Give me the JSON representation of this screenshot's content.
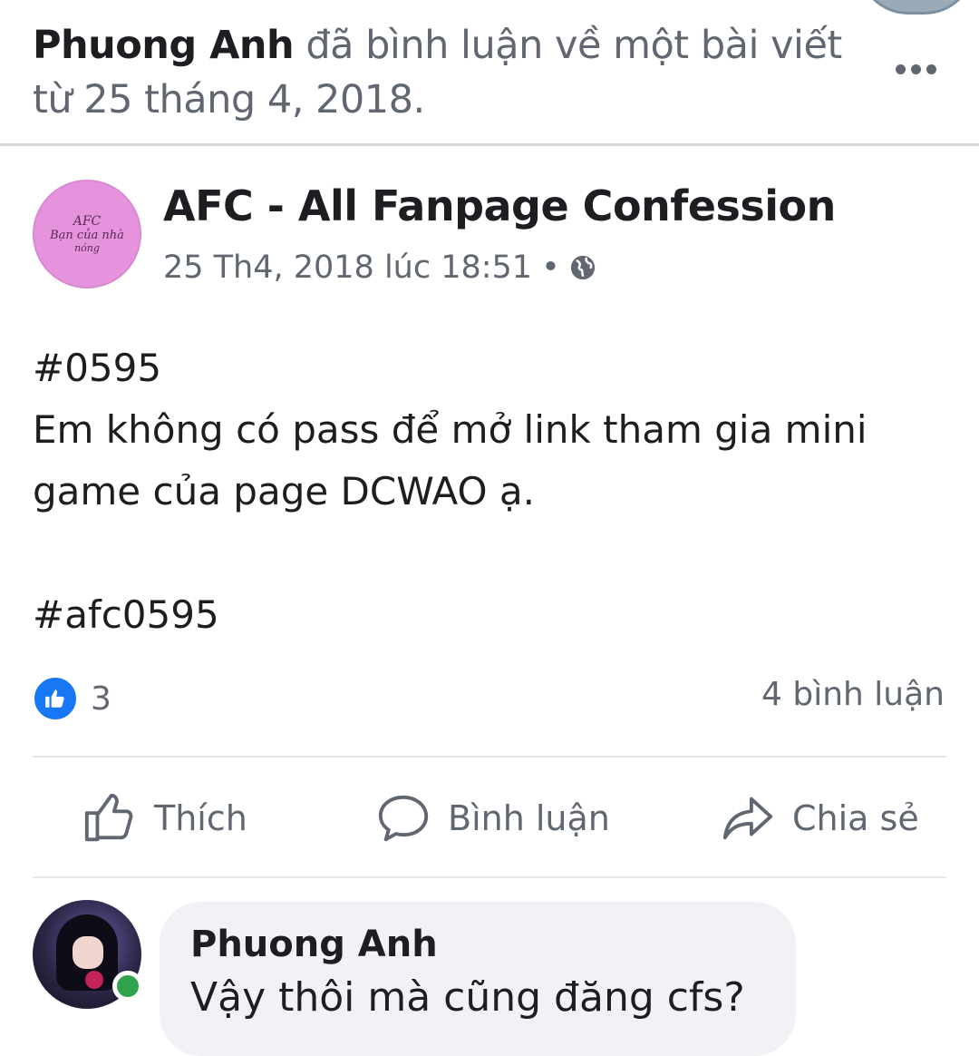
{
  "activity": {
    "actor": "Phuong Anh",
    "text": " đã bình luận về một bài viết từ 25 tháng 4, 2018."
  },
  "post": {
    "page_name": "AFC - All Fanpage Confession",
    "timestamp": "25 Th4, 2018 lúc 18:51",
    "separator": "•",
    "avatar_text": [
      "AFC",
      "Bạn của nhà",
      "nóng"
    ],
    "body_lines": [
      "#0595",
      "Em không có pass để mở link tham gia mini",
      "game của page DCWAO ạ.",
      "",
      "#afc0595"
    ],
    "reaction_count": "3",
    "comment_count": "4 bình luận"
  },
  "actions": {
    "like": "Thích",
    "comment": "Bình luận",
    "share": "Chia sẻ"
  },
  "comment": {
    "author": "Phuong Anh",
    "text": "Vậy thôi mà cũng đăng cfs?"
  },
  "colors": {
    "accent": "#1877f2",
    "online": "#31a24c",
    "bubble": "#f0f2f5",
    "secondary_text": "#606770"
  }
}
